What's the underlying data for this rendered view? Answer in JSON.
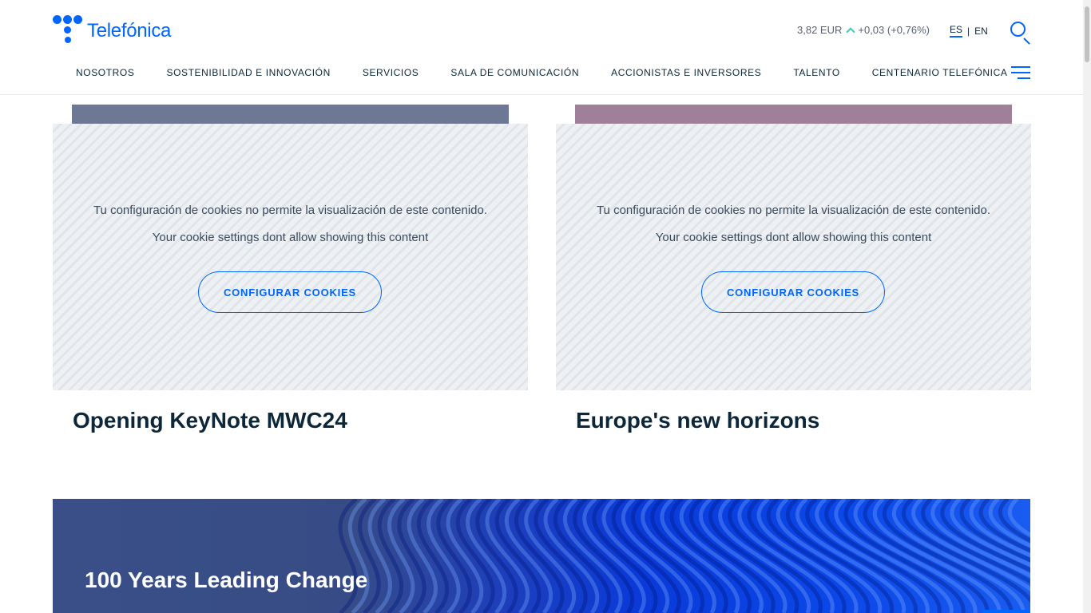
{
  "header": {
    "logo_text": "Telefónica",
    "stock": {
      "price": "3,82 EUR",
      "change": "+0,03 (+0,76%)"
    },
    "languages": [
      "ES",
      "EN"
    ],
    "active_language": "ES",
    "nav": [
      "NOSOTROS",
      "SOSTENIBILIDAD E INNOVACIÓN",
      "SERVICIOS",
      "SALA DE COMUNICACIÓN",
      "ACCIONISTAS E INVERSORES",
      "TALENTO",
      "CENTENARIO TELEFÓNICA"
    ]
  },
  "cards": [
    {
      "title": "Opening KeyNote MWC24",
      "cookie_msg_es": "Tu configuración de cookies no permite la visualización de este contenido.",
      "cookie_msg_en": "Your cookie settings dont allow showing this content",
      "button_label": "CONFIGURAR COOKIES",
      "bar_color": "#6c7894"
    },
    {
      "title": "Europe's new horizons",
      "cookie_msg_es": "Tu configuración de cookies no permite la visualización de este contenido.",
      "cookie_msg_en": "Your cookie settings dont allow showing this content",
      "button_label": "CONFIGURAR COOKIES",
      "bar_color": "#9e8099"
    }
  ],
  "banner": {
    "title": "100 Years Leading Change"
  },
  "colors": {
    "brand": "#0066ff",
    "text": "#0b2739",
    "stock_up": "#3ec8b8"
  }
}
